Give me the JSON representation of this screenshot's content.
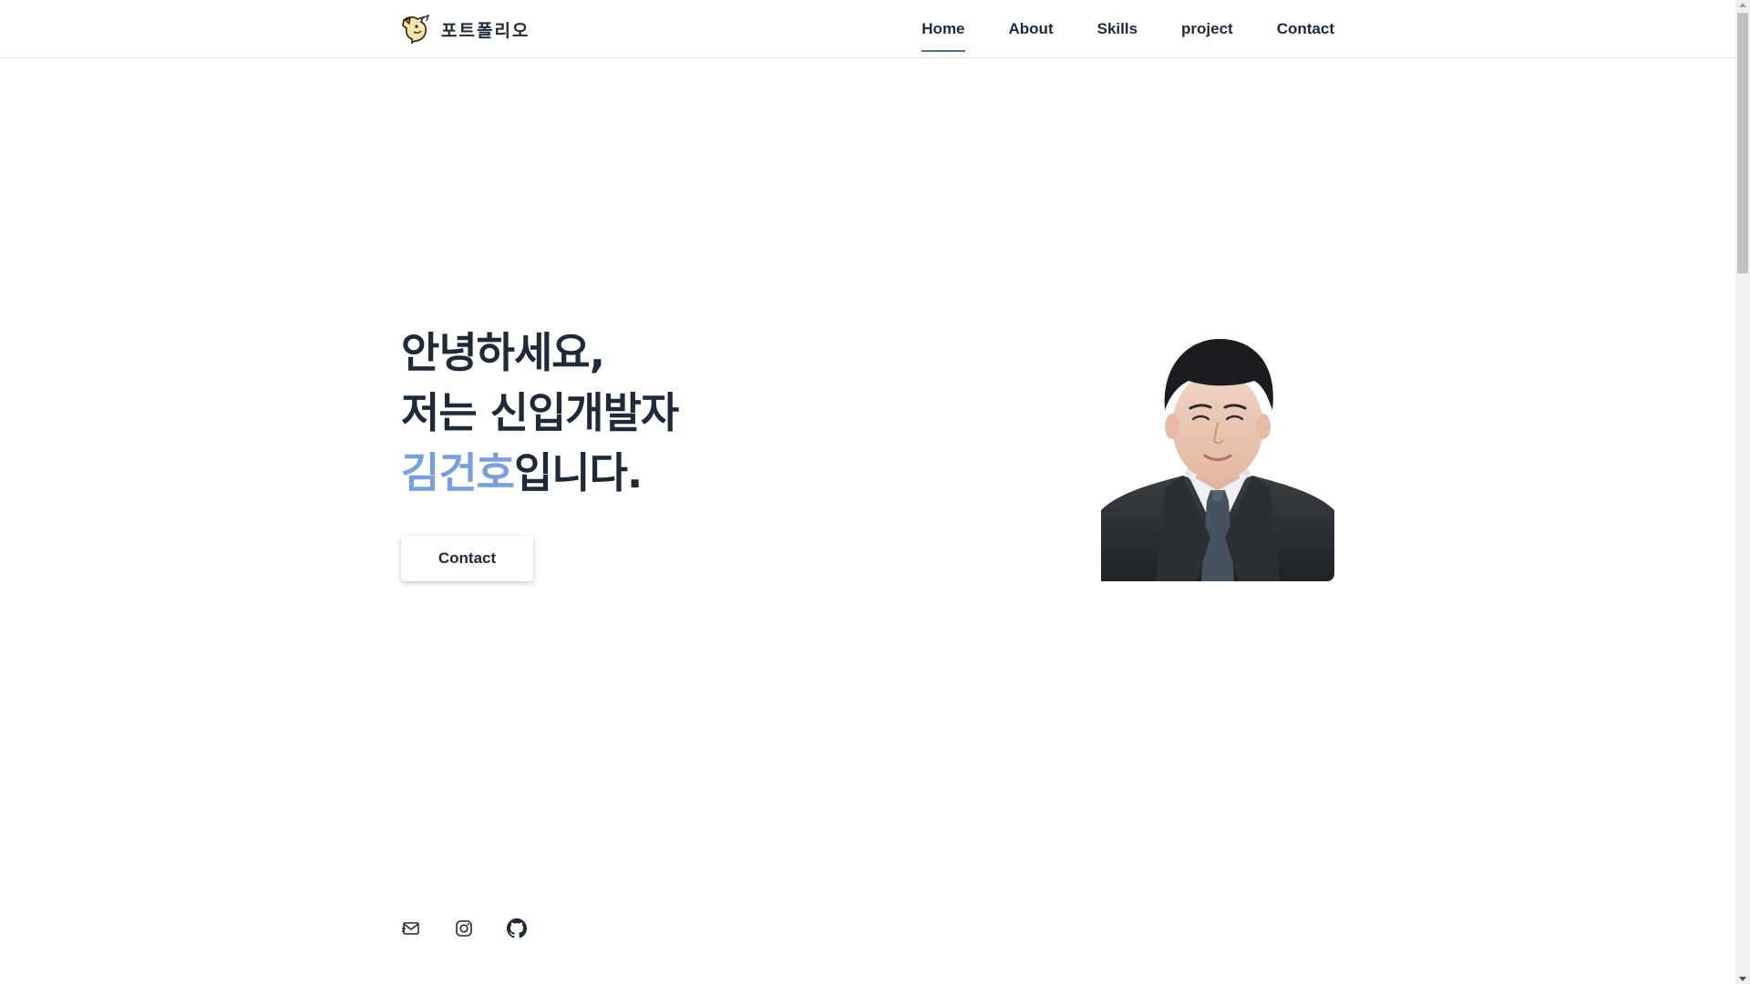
{
  "brand": {
    "name": "포트폴리오",
    "logo_icon": "pokemon-logo-icon"
  },
  "nav": {
    "items": [
      {
        "label": "Home",
        "active": true
      },
      {
        "label": "About",
        "active": false
      },
      {
        "label": "Skills",
        "active": false
      },
      {
        "label": "project",
        "active": false
      },
      {
        "label": "Contact",
        "active": false
      }
    ]
  },
  "hero": {
    "line1": "안녕하세요,",
    "line2": "저는 신입개발자",
    "name": "김건호",
    "line3_suffix": "입니다.",
    "contact_button": "Contact"
  },
  "profile": {
    "photo_icon": "profile-photo"
  },
  "socials": [
    {
      "icon": "mail-icon"
    },
    {
      "icon": "instagram-icon"
    },
    {
      "icon": "github-icon"
    }
  ],
  "colors": {
    "text": "#1e2a3a",
    "accent": "#7a9fe0",
    "nav_underline": "#4a6fa5"
  }
}
